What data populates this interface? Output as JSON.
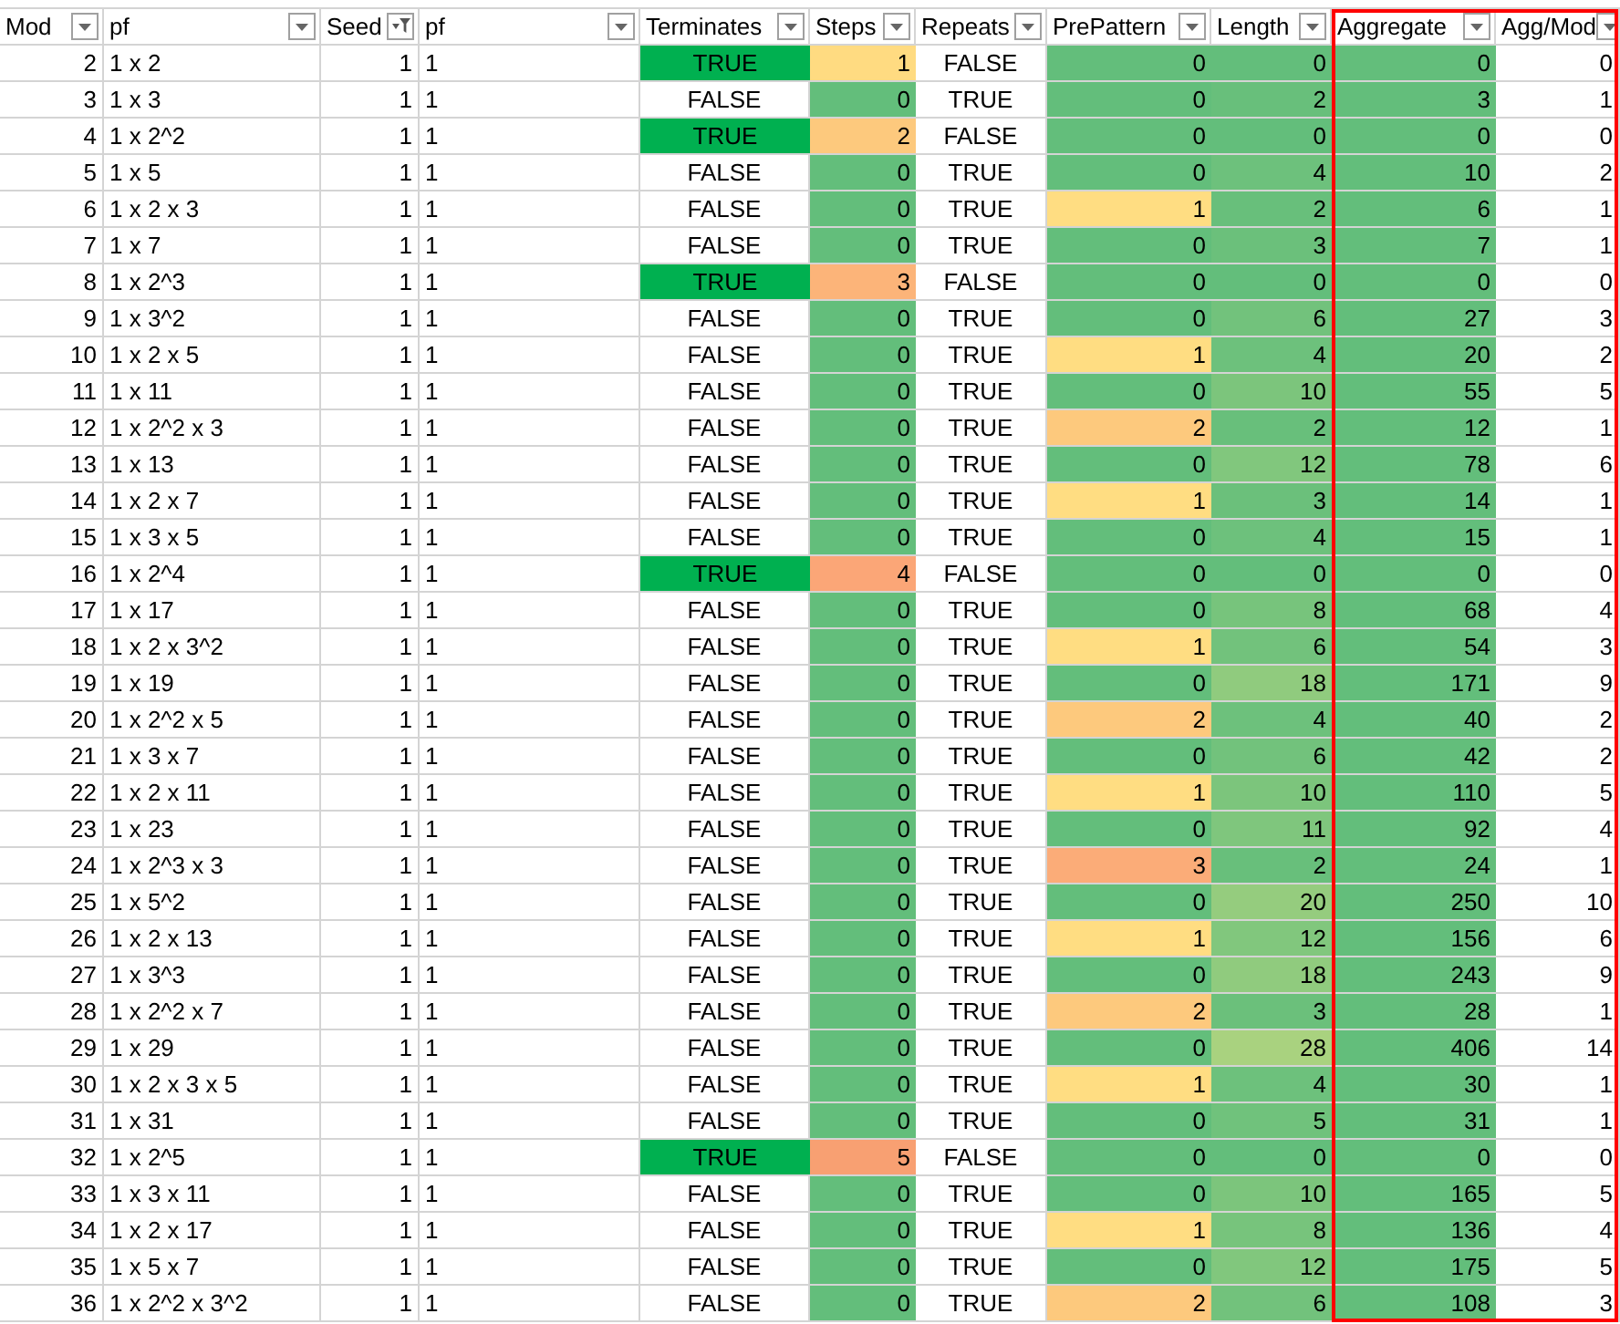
{
  "columns": [
    {
      "label": "Mod",
      "filtered": false
    },
    {
      "label": "pf",
      "filtered": false
    },
    {
      "label": "Seed",
      "filtered": true
    },
    {
      "label": "pf",
      "filtered": false
    },
    {
      "label": "Terminates",
      "filtered": false
    },
    {
      "label": "Steps",
      "filtered": false
    },
    {
      "label": "Repeats",
      "filtered": false
    },
    {
      "label": "PrePattern",
      "filtered": false
    },
    {
      "label": "Length",
      "filtered": false
    },
    {
      "label": "Aggregate",
      "filtered": false
    },
    {
      "label": "Agg/Mod",
      "filtered": false
    }
  ],
  "rows": [
    {
      "mod": "2",
      "pf": "1 x 2",
      "seed": "1",
      "pf_2": "1",
      "terminates": {
        "value": "TRUE",
        "highlighted": true
      },
      "steps": {
        "value": "1",
        "color": "#ffdb81"
      },
      "repeats": "FALSE",
      "prepattern": {
        "value": "0",
        "color": "#63be7b"
      },
      "length": {
        "value": "0",
        "color": "#63be7b"
      },
      "aggregate": {
        "value": "0",
        "color": "#63be7b"
      },
      "agg_mod": "0"
    },
    {
      "mod": "3",
      "pf": "1 x 3",
      "seed": "1",
      "pf_2": "1",
      "terminates": {
        "value": "FALSE",
        "highlighted": false
      },
      "steps": {
        "value": "0",
        "color": "#63be7b"
      },
      "repeats": "TRUE",
      "prepattern": {
        "value": "0",
        "color": "#63be7b"
      },
      "length": {
        "value": "2",
        "color": "#68bf7b"
      },
      "aggregate": {
        "value": "3",
        "color": "#63be7b"
      },
      "agg_mod": "1"
    },
    {
      "mod": "4",
      "pf": "1 x 2^2",
      "seed": "1",
      "pf_2": "1",
      "terminates": {
        "value": "TRUE",
        "highlighted": true
      },
      "steps": {
        "value": "2",
        "color": "#fdc97d"
      },
      "repeats": "FALSE",
      "prepattern": {
        "value": "0",
        "color": "#63be7b"
      },
      "length": {
        "value": "0",
        "color": "#63be7b"
      },
      "aggregate": {
        "value": "0",
        "color": "#63be7b"
      },
      "agg_mod": "0"
    },
    {
      "mod": "5",
      "pf": "1 x 5",
      "seed": "1",
      "pf_2": "1",
      "terminates": {
        "value": "FALSE",
        "highlighted": false
      },
      "steps": {
        "value": "0",
        "color": "#63be7b"
      },
      "repeats": "TRUE",
      "prepattern": {
        "value": "0",
        "color": "#63be7b"
      },
      "length": {
        "value": "4",
        "color": "#6dc17c"
      },
      "aggregate": {
        "value": "10",
        "color": "#63be7b"
      },
      "agg_mod": "2"
    },
    {
      "mod": "6",
      "pf": "1 x 2 x 3",
      "seed": "1",
      "pf_2": "1",
      "terminates": {
        "value": "FALSE",
        "highlighted": false
      },
      "steps": {
        "value": "0",
        "color": "#63be7b"
      },
      "repeats": "TRUE",
      "prepattern": {
        "value": "1",
        "color": "#ffdd82"
      },
      "length": {
        "value": "2",
        "color": "#68bf7b"
      },
      "aggregate": {
        "value": "6",
        "color": "#63be7b"
      },
      "agg_mod": "1"
    },
    {
      "mod": "7",
      "pf": "1 x 7",
      "seed": "1",
      "pf_2": "1",
      "terminates": {
        "value": "FALSE",
        "highlighted": false
      },
      "steps": {
        "value": "0",
        "color": "#63be7b"
      },
      "repeats": "TRUE",
      "prepattern": {
        "value": "0",
        "color": "#63be7b"
      },
      "length": {
        "value": "3",
        "color": "#6bc07b"
      },
      "aggregate": {
        "value": "7",
        "color": "#63be7b"
      },
      "agg_mod": "1"
    },
    {
      "mod": "8",
      "pf": "1 x 2^3",
      "seed": "1",
      "pf_2": "1",
      "terminates": {
        "value": "TRUE",
        "highlighted": true
      },
      "steps": {
        "value": "3",
        "color": "#fcb479"
      },
      "repeats": "FALSE",
      "prepattern": {
        "value": "0",
        "color": "#63be7b"
      },
      "length": {
        "value": "0",
        "color": "#63be7b"
      },
      "aggregate": {
        "value": "0",
        "color": "#63be7b"
      },
      "agg_mod": "0"
    },
    {
      "mod": "9",
      "pf": "1 x 3^2",
      "seed": "1",
      "pf_2": "1",
      "terminates": {
        "value": "FALSE",
        "highlighted": false
      },
      "steps": {
        "value": "0",
        "color": "#63be7b"
      },
      "repeats": "TRUE",
      "prepattern": {
        "value": "0",
        "color": "#63be7b"
      },
      "length": {
        "value": "6",
        "color": "#72c27c"
      },
      "aggregate": {
        "value": "27",
        "color": "#63be7b"
      },
      "agg_mod": "3"
    },
    {
      "mod": "10",
      "pf": "1 x 2 x 5",
      "seed": "1",
      "pf_2": "1",
      "terminates": {
        "value": "FALSE",
        "highlighted": false
      },
      "steps": {
        "value": "0",
        "color": "#63be7b"
      },
      "repeats": "TRUE",
      "prepattern": {
        "value": "1",
        "color": "#ffdd82"
      },
      "length": {
        "value": "4",
        "color": "#6dc17c"
      },
      "aggregate": {
        "value": "20",
        "color": "#63be7b"
      },
      "agg_mod": "2"
    },
    {
      "mod": "11",
      "pf": "1 x 11",
      "seed": "1",
      "pf_2": "1",
      "terminates": {
        "value": "FALSE",
        "highlighted": false
      },
      "steps": {
        "value": "0",
        "color": "#63be7b"
      },
      "repeats": "TRUE",
      "prepattern": {
        "value": "0",
        "color": "#63be7b"
      },
      "length": {
        "value": "10",
        "color": "#7cc57c"
      },
      "aggregate": {
        "value": "55",
        "color": "#63be7b"
      },
      "agg_mod": "5"
    },
    {
      "mod": "12",
      "pf": "1 x 2^2 x 3",
      "seed": "1",
      "pf_2": "1",
      "terminates": {
        "value": "FALSE",
        "highlighted": false
      },
      "steps": {
        "value": "0",
        "color": "#63be7b"
      },
      "repeats": "TRUE",
      "prepattern": {
        "value": "2",
        "color": "#fdc97d"
      },
      "length": {
        "value": "2",
        "color": "#68bf7b"
      },
      "aggregate": {
        "value": "12",
        "color": "#63be7b"
      },
      "agg_mod": "1"
    },
    {
      "mod": "13",
      "pf": "1 x 13",
      "seed": "1",
      "pf_2": "1",
      "terminates": {
        "value": "FALSE",
        "highlighted": false
      },
      "steps": {
        "value": "0",
        "color": "#63be7b"
      },
      "repeats": "TRUE",
      "prepattern": {
        "value": "0",
        "color": "#63be7b"
      },
      "length": {
        "value": "12",
        "color": "#81c77d"
      },
      "aggregate": {
        "value": "78",
        "color": "#63be7b"
      },
      "agg_mod": "6"
    },
    {
      "mod": "14",
      "pf": "1 x 2 x 7",
      "seed": "1",
      "pf_2": "1",
      "terminates": {
        "value": "FALSE",
        "highlighted": false
      },
      "steps": {
        "value": "0",
        "color": "#63be7b"
      },
      "repeats": "TRUE",
      "prepattern": {
        "value": "1",
        "color": "#ffdd82"
      },
      "length": {
        "value": "3",
        "color": "#6bc07b"
      },
      "aggregate": {
        "value": "14",
        "color": "#63be7b"
      },
      "agg_mod": "1"
    },
    {
      "mod": "15",
      "pf": "1 x 3 x 5",
      "seed": "1",
      "pf_2": "1",
      "terminates": {
        "value": "FALSE",
        "highlighted": false
      },
      "steps": {
        "value": "0",
        "color": "#63be7b"
      },
      "repeats": "TRUE",
      "prepattern": {
        "value": "0",
        "color": "#63be7b"
      },
      "length": {
        "value": "4",
        "color": "#6dc17c"
      },
      "aggregate": {
        "value": "15",
        "color": "#63be7b"
      },
      "agg_mod": "1"
    },
    {
      "mod": "16",
      "pf": "1 x 2^4",
      "seed": "1",
      "pf_2": "1",
      "terminates": {
        "value": "TRUE",
        "highlighted": true
      },
      "steps": {
        "value": "4",
        "color": "#fba677"
      },
      "repeats": "FALSE",
      "prepattern": {
        "value": "0",
        "color": "#63be7b"
      },
      "length": {
        "value": "0",
        "color": "#63be7b"
      },
      "aggregate": {
        "value": "0",
        "color": "#63be7b"
      },
      "agg_mod": "0"
    },
    {
      "mod": "17",
      "pf": "1 x 17",
      "seed": "1",
      "pf_2": "1",
      "terminates": {
        "value": "FALSE",
        "highlighted": false
      },
      "steps": {
        "value": "0",
        "color": "#63be7b"
      },
      "repeats": "TRUE",
      "prepattern": {
        "value": "0",
        "color": "#63be7b"
      },
      "length": {
        "value": "8",
        "color": "#77c47c"
      },
      "aggregate": {
        "value": "68",
        "color": "#63be7b"
      },
      "agg_mod": "4"
    },
    {
      "mod": "18",
      "pf": "1 x 2 x 3^2",
      "seed": "1",
      "pf_2": "1",
      "terminates": {
        "value": "FALSE",
        "highlighted": false
      },
      "steps": {
        "value": "0",
        "color": "#63be7b"
      },
      "repeats": "TRUE",
      "prepattern": {
        "value": "1",
        "color": "#ffdd82"
      },
      "length": {
        "value": "6",
        "color": "#72c27c"
      },
      "aggregate": {
        "value": "54",
        "color": "#63be7b"
      },
      "agg_mod": "3"
    },
    {
      "mod": "19",
      "pf": "1 x 19",
      "seed": "1",
      "pf_2": "1",
      "terminates": {
        "value": "FALSE",
        "highlighted": false
      },
      "steps": {
        "value": "0",
        "color": "#63be7b"
      },
      "repeats": "TRUE",
      "prepattern": {
        "value": "0",
        "color": "#63be7b"
      },
      "length": {
        "value": "18",
        "color": "#90cb7e"
      },
      "aggregate": {
        "value": "171",
        "color": "#63be7b"
      },
      "agg_mod": "9"
    },
    {
      "mod": "20",
      "pf": "1 x 2^2 x 5",
      "seed": "1",
      "pf_2": "1",
      "terminates": {
        "value": "FALSE",
        "highlighted": false
      },
      "steps": {
        "value": "0",
        "color": "#63be7b"
      },
      "repeats": "TRUE",
      "prepattern": {
        "value": "2",
        "color": "#fdc97d"
      },
      "length": {
        "value": "4",
        "color": "#6dc17c"
      },
      "aggregate": {
        "value": "40",
        "color": "#63be7b"
      },
      "agg_mod": "2"
    },
    {
      "mod": "21",
      "pf": "1 x 3 x 7",
      "seed": "1",
      "pf_2": "1",
      "terminates": {
        "value": "FALSE",
        "highlighted": false
      },
      "steps": {
        "value": "0",
        "color": "#63be7b"
      },
      "repeats": "TRUE",
      "prepattern": {
        "value": "0",
        "color": "#63be7b"
      },
      "length": {
        "value": "6",
        "color": "#72c27c"
      },
      "aggregate": {
        "value": "42",
        "color": "#63be7b"
      },
      "agg_mod": "2"
    },
    {
      "mod": "22",
      "pf": "1 x 2 x 11",
      "seed": "1",
      "pf_2": "1",
      "terminates": {
        "value": "FALSE",
        "highlighted": false
      },
      "steps": {
        "value": "0",
        "color": "#63be7b"
      },
      "repeats": "TRUE",
      "prepattern": {
        "value": "1",
        "color": "#ffdd82"
      },
      "length": {
        "value": "10",
        "color": "#7cc57c"
      },
      "aggregate": {
        "value": "110",
        "color": "#63be7b"
      },
      "agg_mod": "5"
    },
    {
      "mod": "23",
      "pf": "1 x 23",
      "seed": "1",
      "pf_2": "1",
      "terminates": {
        "value": "FALSE",
        "highlighted": false
      },
      "steps": {
        "value": "0",
        "color": "#63be7b"
      },
      "repeats": "TRUE",
      "prepattern": {
        "value": "0",
        "color": "#63be7b"
      },
      "length": {
        "value": "11",
        "color": "#7fc67d"
      },
      "aggregate": {
        "value": "92",
        "color": "#63be7b"
      },
      "agg_mod": "4"
    },
    {
      "mod": "24",
      "pf": "1 x 2^3 x 3",
      "seed": "1",
      "pf_2": "1",
      "terminates": {
        "value": "FALSE",
        "highlighted": false
      },
      "steps": {
        "value": "0",
        "color": "#63be7b"
      },
      "repeats": "TRUE",
      "prepattern": {
        "value": "3",
        "color": "#fbac78"
      },
      "length": {
        "value": "2",
        "color": "#68bf7b"
      },
      "aggregate": {
        "value": "24",
        "color": "#63be7b"
      },
      "agg_mod": "1"
    },
    {
      "mod": "25",
      "pf": "1 x 5^2",
      "seed": "1",
      "pf_2": "1",
      "terminates": {
        "value": "FALSE",
        "highlighted": false
      },
      "steps": {
        "value": "0",
        "color": "#63be7b"
      },
      "repeats": "TRUE",
      "prepattern": {
        "value": "0",
        "color": "#63be7b"
      },
      "length": {
        "value": "20",
        "color": "#95cc7e"
      },
      "aggregate": {
        "value": "250",
        "color": "#63be7b"
      },
      "agg_mod": "10"
    },
    {
      "mod": "26",
      "pf": "1 x 2 x 13",
      "seed": "1",
      "pf_2": "1",
      "terminates": {
        "value": "FALSE",
        "highlighted": false
      },
      "steps": {
        "value": "0",
        "color": "#63be7b"
      },
      "repeats": "TRUE",
      "prepattern": {
        "value": "1",
        "color": "#ffdd82"
      },
      "length": {
        "value": "12",
        "color": "#81c77d"
      },
      "aggregate": {
        "value": "156",
        "color": "#63be7b"
      },
      "agg_mod": "6"
    },
    {
      "mod": "27",
      "pf": "1 x 3^3",
      "seed": "1",
      "pf_2": "1",
      "terminates": {
        "value": "FALSE",
        "highlighted": false
      },
      "steps": {
        "value": "0",
        "color": "#63be7b"
      },
      "repeats": "TRUE",
      "prepattern": {
        "value": "0",
        "color": "#63be7b"
      },
      "length": {
        "value": "18",
        "color": "#90cb7e"
      },
      "aggregate": {
        "value": "243",
        "color": "#63be7b"
      },
      "agg_mod": "9"
    },
    {
      "mod": "28",
      "pf": "1 x 2^2 x 7",
      "seed": "1",
      "pf_2": "1",
      "terminates": {
        "value": "FALSE",
        "highlighted": false
      },
      "steps": {
        "value": "0",
        "color": "#63be7b"
      },
      "repeats": "TRUE",
      "prepattern": {
        "value": "2",
        "color": "#fdc97d"
      },
      "length": {
        "value": "3",
        "color": "#6bc07b"
      },
      "aggregate": {
        "value": "28",
        "color": "#63be7b"
      },
      "agg_mod": "1"
    },
    {
      "mod": "29",
      "pf": "1 x 29",
      "seed": "1",
      "pf_2": "1",
      "terminates": {
        "value": "FALSE",
        "highlighted": false
      },
      "steps": {
        "value": "0",
        "color": "#63be7b"
      },
      "repeats": "TRUE",
      "prepattern": {
        "value": "0",
        "color": "#63be7b"
      },
      "length": {
        "value": "28",
        "color": "#a9d27f"
      },
      "aggregate": {
        "value": "406",
        "color": "#63be7b"
      },
      "agg_mod": "14"
    },
    {
      "mod": "30",
      "pf": "1 x 2 x 3 x 5",
      "seed": "1",
      "pf_2": "1",
      "terminates": {
        "value": "FALSE",
        "highlighted": false
      },
      "steps": {
        "value": "0",
        "color": "#63be7b"
      },
      "repeats": "TRUE",
      "prepattern": {
        "value": "1",
        "color": "#ffdd82"
      },
      "length": {
        "value": "4",
        "color": "#6dc17c"
      },
      "aggregate": {
        "value": "30",
        "color": "#63be7b"
      },
      "agg_mod": "1"
    },
    {
      "mod": "31",
      "pf": "1 x 31",
      "seed": "1",
      "pf_2": "1",
      "terminates": {
        "value": "FALSE",
        "highlighted": false
      },
      "steps": {
        "value": "0",
        "color": "#63be7b"
      },
      "repeats": "TRUE",
      "prepattern": {
        "value": "0",
        "color": "#63be7b"
      },
      "length": {
        "value": "5",
        "color": "#70c27c"
      },
      "aggregate": {
        "value": "31",
        "color": "#63be7b"
      },
      "agg_mod": "1"
    },
    {
      "mod": "32",
      "pf": "1 x 2^5",
      "seed": "1",
      "pf_2": "1",
      "terminates": {
        "value": "TRUE",
        "highlighted": true
      },
      "steps": {
        "value": "5",
        "color": "#f8a072"
      },
      "repeats": "FALSE",
      "prepattern": {
        "value": "0",
        "color": "#63be7b"
      },
      "length": {
        "value": "0",
        "color": "#63be7b"
      },
      "aggregate": {
        "value": "0",
        "color": "#63be7b"
      },
      "agg_mod": "0"
    },
    {
      "mod": "33",
      "pf": "1 x 3 x 11",
      "seed": "1",
      "pf_2": "1",
      "terminates": {
        "value": "FALSE",
        "highlighted": false
      },
      "steps": {
        "value": "0",
        "color": "#63be7b"
      },
      "repeats": "TRUE",
      "prepattern": {
        "value": "0",
        "color": "#63be7b"
      },
      "length": {
        "value": "10",
        "color": "#7cc57c"
      },
      "aggregate": {
        "value": "165",
        "color": "#63be7b"
      },
      "agg_mod": "5"
    },
    {
      "mod": "34",
      "pf": "1 x 2 x 17",
      "seed": "1",
      "pf_2": "1",
      "terminates": {
        "value": "FALSE",
        "highlighted": false
      },
      "steps": {
        "value": "0",
        "color": "#63be7b"
      },
      "repeats": "TRUE",
      "prepattern": {
        "value": "1",
        "color": "#ffdd82"
      },
      "length": {
        "value": "8",
        "color": "#77c47c"
      },
      "aggregate": {
        "value": "136",
        "color": "#63be7b"
      },
      "agg_mod": "4"
    },
    {
      "mod": "35",
      "pf": "1 x 5 x 7",
      "seed": "1",
      "pf_2": "1",
      "terminates": {
        "value": "FALSE",
        "highlighted": false
      },
      "steps": {
        "value": "0",
        "color": "#63be7b"
      },
      "repeats": "TRUE",
      "prepattern": {
        "value": "0",
        "color": "#63be7b"
      },
      "length": {
        "value": "12",
        "color": "#81c77d"
      },
      "aggregate": {
        "value": "175",
        "color": "#63be7b"
      },
      "agg_mod": "5"
    },
    {
      "mod": "36",
      "pf": "1 x 2^2 x 3^2",
      "seed": "1",
      "pf_2": "1",
      "terminates": {
        "value": "FALSE",
        "highlighted": false
      },
      "steps": {
        "value": "0",
        "color": "#63be7b"
      },
      "repeats": "TRUE",
      "prepattern": {
        "value": "2",
        "color": "#fdc97d"
      },
      "length": {
        "value": "6",
        "color": "#72c27c"
      },
      "aggregate": {
        "value": "108",
        "color": "#63be7b"
      },
      "agg_mod": "3"
    }
  ]
}
